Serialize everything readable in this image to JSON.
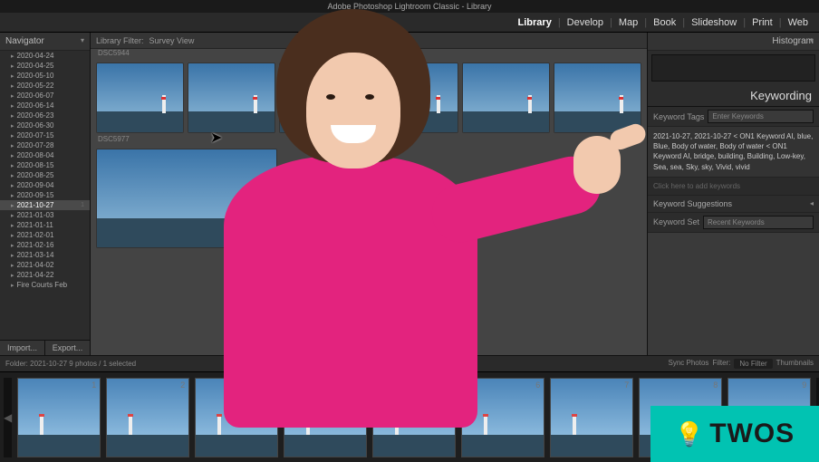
{
  "titlebar": "Adobe Photoshop Lightroom Classic - Library",
  "menu": {
    "items": [
      "Library",
      "Develop",
      "Map",
      "Book",
      "Slideshow",
      "Print",
      "Web"
    ],
    "active": "Library"
  },
  "left": {
    "navigator": "Navigator",
    "folders": [
      {
        "name": "2020-04-24",
        "count": ""
      },
      {
        "name": "2020-04-25",
        "count": ""
      },
      {
        "name": "2020-05-10",
        "count": ""
      },
      {
        "name": "2020-05-22",
        "count": ""
      },
      {
        "name": "2020-06-07",
        "count": ""
      },
      {
        "name": "2020-06-14",
        "count": ""
      },
      {
        "name": "2020-06-23",
        "count": ""
      },
      {
        "name": "2020-06-30",
        "count": ""
      },
      {
        "name": "2020-07-15",
        "count": ""
      },
      {
        "name": "2020-07-28",
        "count": ""
      },
      {
        "name": "2020-08-04",
        "count": ""
      },
      {
        "name": "2020-08-15",
        "count": ""
      },
      {
        "name": "2020-08-25",
        "count": ""
      },
      {
        "name": "2020-09-04",
        "count": ""
      },
      {
        "name": "2020-09-15",
        "count": ""
      },
      {
        "name": "2021-10-27",
        "count": "1"
      },
      {
        "name": "2021-01-03",
        "count": ""
      },
      {
        "name": "2021-01-11",
        "count": ""
      },
      {
        "name": "2021-02-01",
        "count": ""
      },
      {
        "name": "2021-02-16",
        "count": ""
      },
      {
        "name": "2021-03-14",
        "count": ""
      },
      {
        "name": "2021-04-02",
        "count": ""
      },
      {
        "name": "2021-04-22",
        "count": ""
      },
      {
        "name": "Fire Courts Feb",
        "count": ""
      }
    ],
    "selected_index": 15,
    "import": "Import...",
    "export": "Export..."
  },
  "center": {
    "library_filter": "Library Filter:",
    "survey_view": "Survey View",
    "group_label_1": "DSC5944",
    "group_label_2": "DSC5977"
  },
  "right": {
    "histogram": "Histogram",
    "keywording": "Keywording",
    "keyword_tags": "Keyword Tags",
    "enter_keywords": "Enter Keywords",
    "keywords_body": "2021-10-27, 2021-10-27 < ON1 Keyword AI, blue, Blue, Body of water, Body of water < ON1 Keyword AI, bridge, building, Building, Low-key, Sea, sea, Sky, sky, Vivid, vivid",
    "click_add": "Click here to add keywords",
    "suggestions": "Keyword Suggestions",
    "keyword_set": "Keyword Set",
    "recent": "Recent Keywords"
  },
  "status": {
    "info": "Folder: 2021-10-27   9 photos / 1 selected",
    "sync": "Sync Photos",
    "filter": "Filter:",
    "nofilter": "No Filter",
    "thumbnails": "Thumbnails"
  },
  "filmstrip": {
    "count": 9
  },
  "logo": "TWOS"
}
